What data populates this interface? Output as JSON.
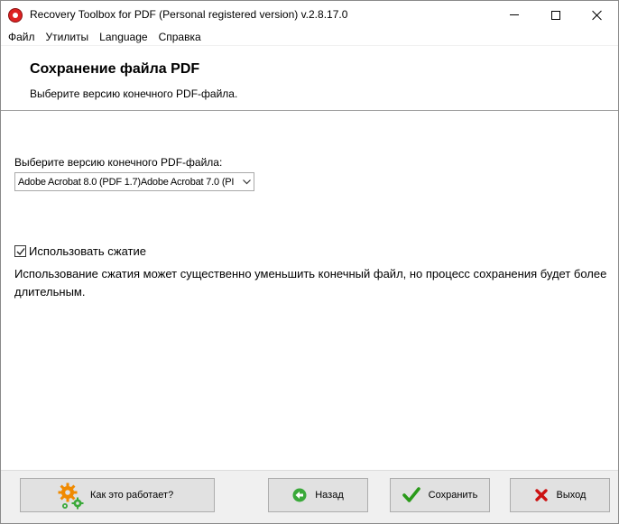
{
  "window": {
    "title": "Recovery Toolbox for PDF (Personal registered version) v.2.8.17.0",
    "app_icon": "recovery-toolbox-icon"
  },
  "menu": {
    "items": [
      "Файл",
      "Утилиты",
      "Language",
      "Справка"
    ]
  },
  "header": {
    "title": "Сохранение файла PDF",
    "subtitle": "Выберите версию конечного PDF-файла."
  },
  "content": {
    "version_label": "Выберите версию конечного PDF-файла:",
    "version_selected": "Adobe Acrobat 8.0 (PDF 1.7)Adobe Acrobat 7.0 (PI",
    "compress_label": "Использовать сжатие",
    "compress_checked": true,
    "compress_desc": "Использование сжатия может существенно уменьшить конечный файл, но процесс сохранения будет более длительным."
  },
  "footer": {
    "howto_label": "Как это работает?",
    "back_label": "Назад",
    "save_label": "Сохранить",
    "exit_label": "Выход"
  },
  "colors": {
    "back_icon": "#3aa93a",
    "save_icon": "#2a9a1a",
    "exit_icon": "#cc1111",
    "gear_orange": "#f08a00",
    "gear_green": "#3aa93a"
  }
}
